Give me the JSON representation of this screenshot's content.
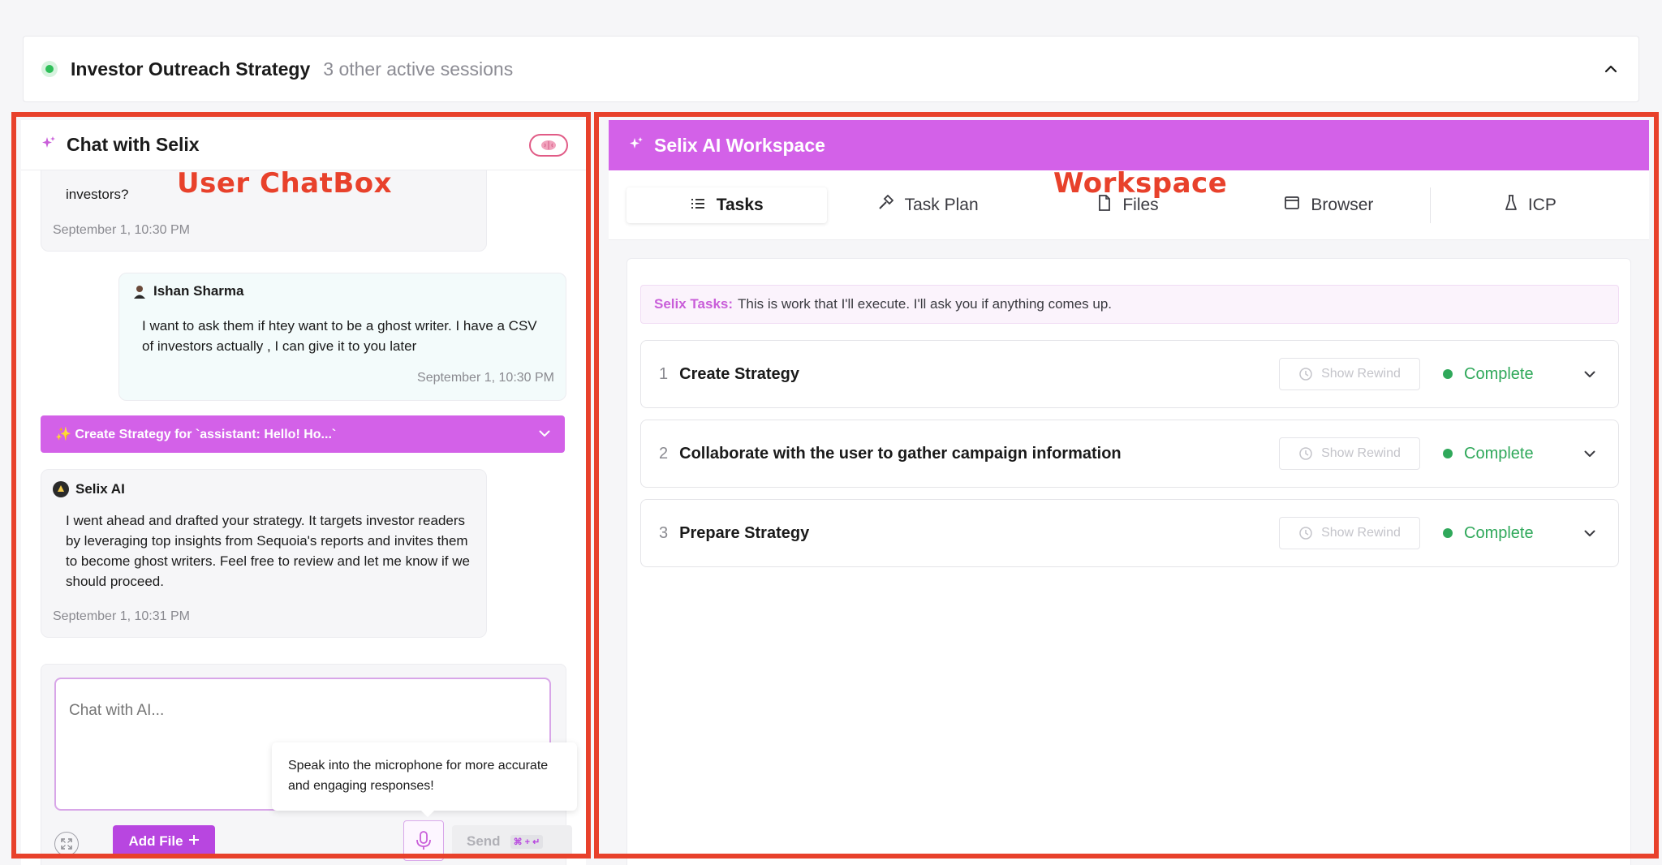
{
  "session": {
    "title": "Investor Outreach Strategy",
    "subtitle": "3 other active sessions",
    "status_color": "#2fbf59"
  },
  "annotations": {
    "chat_label": "User ChatBox",
    "workspace_label": "Workspace",
    "color": "#e8412b"
  },
  "chat": {
    "title": "Chat with Selix",
    "messages": [
      {
        "role": "assistant",
        "text": "investors?",
        "time": "September 1, 10:30 PM"
      },
      {
        "role": "user",
        "author": "Ishan Sharma",
        "text": "I want to ask them if htey want to be a ghost writer. I have a CSV of investors actually , I can give it to you later",
        "time": "September 1, 10:30 PM"
      },
      {
        "role": "assistant",
        "author": "Selix AI",
        "text": "I went ahead and drafted your strategy. It targets investor readers by leveraging top insights from Sequoia's reports and invites them to become ghost writers. Feel free to review and let me know if we should proceed.",
        "time": "September 1, 10:31 PM"
      }
    ],
    "strategy_bar": "✨ Create Strategy for `assistant: Hello! Ho...`",
    "input_placeholder": "Chat with AI...",
    "tooltip": "Speak into the microphone for more accurate and engaging responses!",
    "add_file_label": "Add File",
    "send_label": "Send",
    "send_shortcut": "⌘ + ↵"
  },
  "workspace": {
    "title": "Selix AI Workspace",
    "tabs": [
      {
        "label": "Tasks",
        "icon": "list-icon",
        "active": true
      },
      {
        "label": "Task Plan",
        "icon": "hammer-icon",
        "active": false
      },
      {
        "label": "Files",
        "icon": "file-icon",
        "active": false
      },
      {
        "label": "Browser",
        "icon": "browser-icon",
        "active": false
      },
      {
        "label": "ICP",
        "icon": "flask-icon",
        "active": false
      }
    ],
    "banner_prefix": "Selix Tasks:",
    "banner_text": "This is work that I'll execute. I'll ask you if anything comes up.",
    "tasks": [
      {
        "num": "1",
        "name": "Create Strategy",
        "rewind": "Show Rewind",
        "status": "Complete"
      },
      {
        "num": "2",
        "name": "Collaborate with the user to gather campaign information",
        "rewind": "Show Rewind",
        "status": "Complete"
      },
      {
        "num": "3",
        "name": "Prepare Strategy",
        "rewind": "Show Rewind",
        "status": "Complete"
      }
    ],
    "accent_color": "#d361e8",
    "status_color": "#2fa85a"
  }
}
